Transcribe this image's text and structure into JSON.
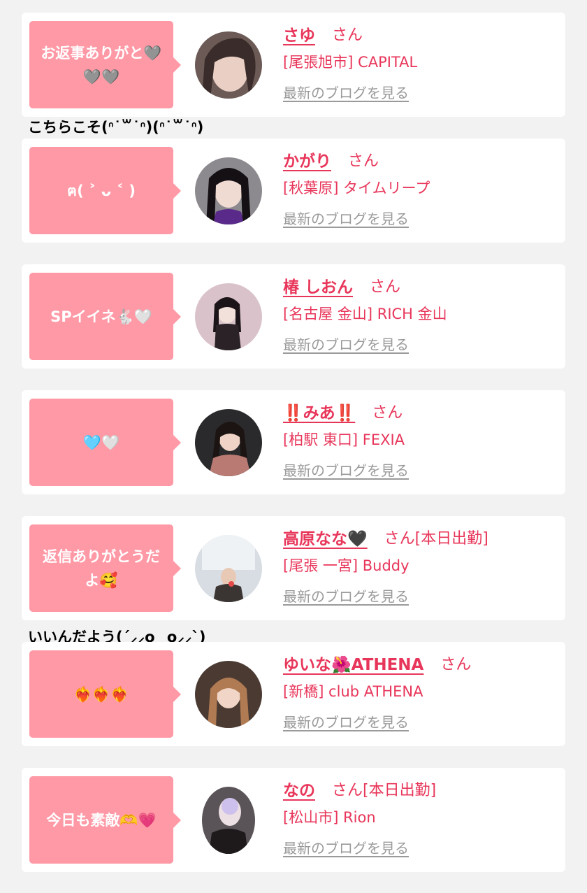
{
  "items": [
    {
      "message": "お返事ありがと🩶🩶🩶",
      "name": "さゆ",
      "honorific": "さん",
      "today": "",
      "shop": "[尾張旭市] CAPITAL",
      "blog": "最新のブログを見る",
      "reply": "こちらこそ(ᐢ˙꒳˙ᐢ)(ᐢ˙꒳˙ᐢ)"
    },
    {
      "message": "ฅ( ˃ ᴗ ˂ )",
      "name": "かがり",
      "honorific": "さん",
      "today": "",
      "shop": "[秋葉原] タイムリープ",
      "blog": "最新のブログを見る",
      "reply": ""
    },
    {
      "message": "SPイイネ🐇🤍",
      "name": "椿 しおん",
      "honorific": "さん",
      "today": "",
      "shop": "[名古屋 金山] RICH 金山",
      "blog": "最新のブログを見る",
      "reply": ""
    },
    {
      "message": "🩵🤍",
      "name": "‼️みあ‼️",
      "honorific": "さん",
      "today": "",
      "shop": "[柏駅 東口] FEXIA",
      "blog": "最新のブログを見る",
      "reply": ""
    },
    {
      "message": "返信ありがとうだよ🥰",
      "name": "高原なな🖤",
      "honorific": "さん",
      "today": "[本日出勤]",
      "shop": "[尾張 一宮] Buddy",
      "blog": "最新のブログを見る",
      "reply": "いいんだよう(´⸝⸝o‿o⸝⸝`)"
    },
    {
      "message": "❤️‍🔥❤️‍🔥❤️‍🔥",
      "name": "ゆいな🌺ATHENA",
      "honorific": "さん",
      "today": "",
      "shop": "[新橋] club ATHENA",
      "blog": "最新のブログを見る",
      "reply": ""
    },
    {
      "message": "今日も素敵🫶💗",
      "name": "なの",
      "honorific": "さん",
      "today": "[本日出勤]",
      "shop": "[松山市] Rion",
      "blog": "最新のブログを見る",
      "reply": ""
    }
  ],
  "colors": {
    "bubble": "#ff99a6",
    "accent": "#e8365a",
    "muted": "#9a9a9a",
    "background": "#f2f2f2"
  }
}
